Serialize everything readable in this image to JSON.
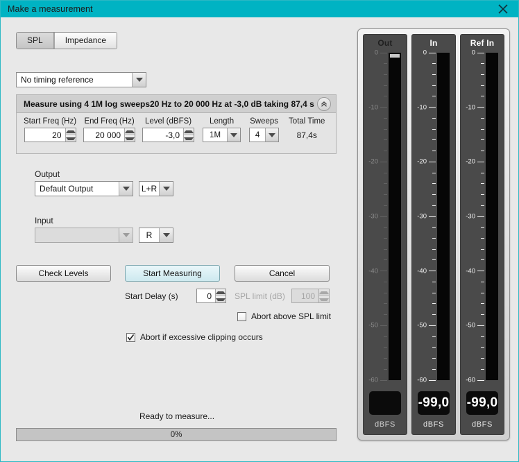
{
  "window": {
    "title": "Make a measurement",
    "close_icon": "close-icon",
    "titlebar_color": "#00b3c3",
    "background_color": "#e8e8e8"
  },
  "mode_tabs": [
    {
      "label": "SPL",
      "active": true
    },
    {
      "label": "Impedance",
      "active": false
    }
  ],
  "timing_reference": {
    "value": "No timing reference",
    "arrow_icon": "chevron-down-icon"
  },
  "measure_group": {
    "banner_text": "Measure using 4 1M log sweeps20 Hz to 20 000 Hz at -3,0 dB taking 87,4 s",
    "collapse_icon": "double-chevron-up-icon",
    "params": [
      {
        "label": "Start Freq (Hz)",
        "value": "20",
        "kind": "spinner"
      },
      {
        "label": "End Freq (Hz)",
        "value": "20 000",
        "kind": "spinner"
      },
      {
        "label": "Level (dBFS)",
        "value": "-3,0",
        "kind": "spinner"
      },
      {
        "label": "Length",
        "value": "1M",
        "kind": "combo"
      },
      {
        "label": "Sweeps",
        "value": "4",
        "kind": "combo"
      },
      {
        "label": "Total Time",
        "value": "87,4s",
        "kind": "text"
      }
    ]
  },
  "output": {
    "label": "Output",
    "device": "Default Output",
    "channel": "L+R",
    "enabled": true
  },
  "input": {
    "label": "Input",
    "device": "",
    "channel": "R",
    "enabled": false
  },
  "buttons": {
    "check_levels": "Check Levels",
    "start_measuring": "Start Measuring",
    "cancel": "Cancel"
  },
  "start_delay": {
    "label": "Start Delay (s)",
    "value": "0"
  },
  "spl_limit": {
    "label": "SPL limit (dB)",
    "value": "100",
    "enabled": false
  },
  "checkboxes": [
    {
      "label": "Abort above SPL limit",
      "checked": false
    },
    {
      "label": "Abort if excessive clipping occurs",
      "checked": true
    }
  ],
  "status": {
    "text": "Ready to measure...",
    "progress_label": "0%",
    "progress_percent": 0
  },
  "meters": [
    {
      "title": "Out",
      "unit": "dBFS",
      "readout": "",
      "active": false,
      "marker": true,
      "tick_labels": [
        "0",
        "-10",
        "-20",
        "-30",
        "-40",
        "-50",
        "-60"
      ]
    },
    {
      "title": "In",
      "unit": "dBFS",
      "readout": "-99,0",
      "active": true,
      "marker": false,
      "tick_labels": [
        "0",
        "-10",
        "-20",
        "-30",
        "-40",
        "-50",
        "-60"
      ]
    },
    {
      "title": "Ref In",
      "unit": "dBFS",
      "readout": "-99,0",
      "active": true,
      "marker": false,
      "tick_labels": [
        "0",
        "-10",
        "-20",
        "-30",
        "-40",
        "-50",
        "-60"
      ]
    }
  ]
}
